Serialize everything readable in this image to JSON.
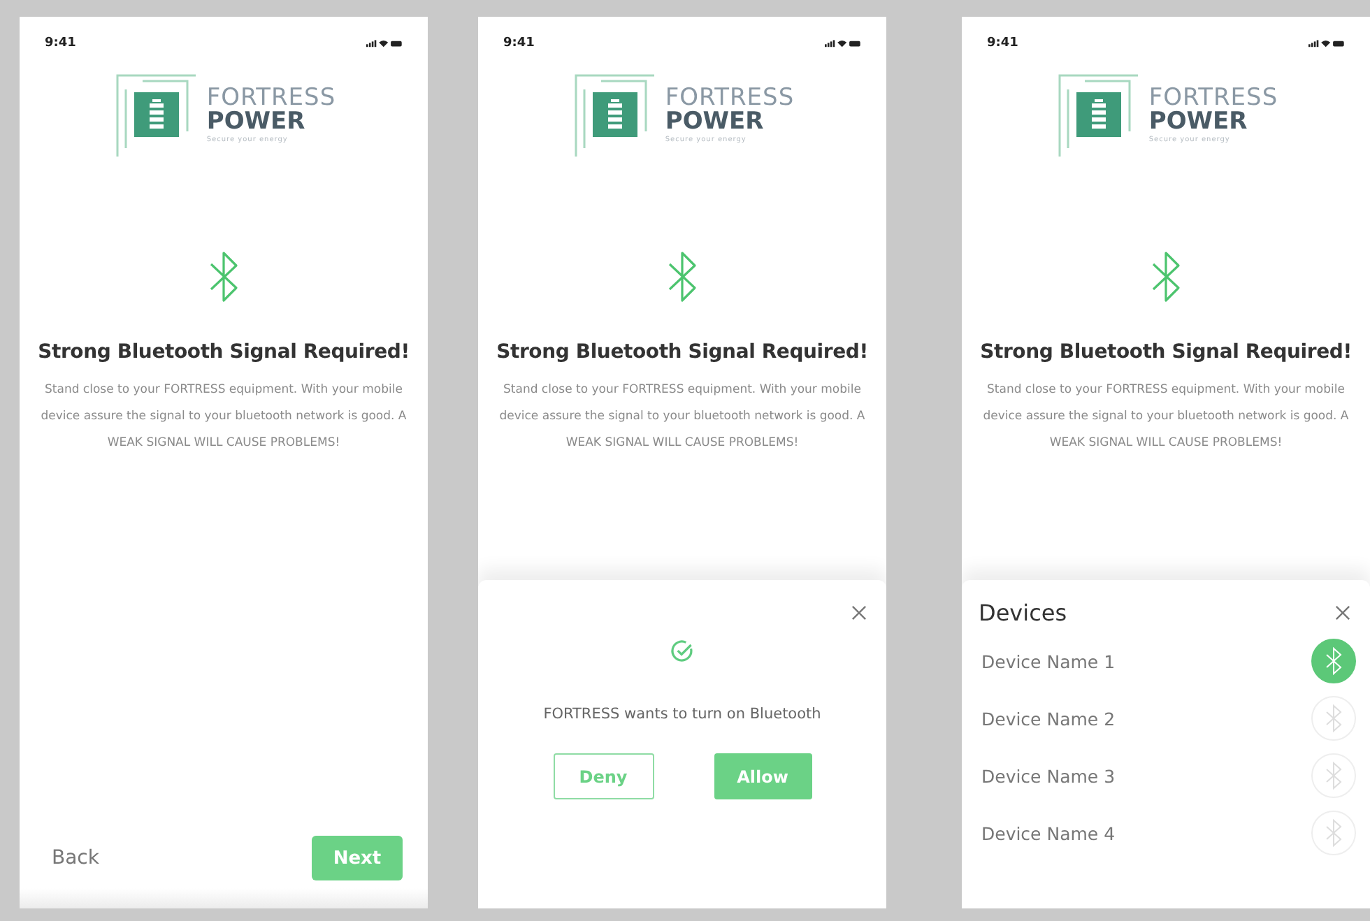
{
  "screens": [
    {
      "kind": "intro",
      "status": {
        "time": "9:41"
      },
      "logo": {
        "line1": "FORTRESS",
        "line2": "POWER",
        "tagline": "Secure your energy"
      },
      "title": "Strong Bluetooth Signal Required!",
      "body": "Stand close to your FORTRESS equipment. With your mobile device assure the signal to your bluetooth network is good. A WEAK SIGNAL WILL CAUSE PROBLEMS!",
      "footer": {
        "back": "Back",
        "next": "Next"
      }
    },
    {
      "kind": "permission",
      "status": {
        "time": "9:41"
      },
      "logo": {
        "line1": "FORTRESS",
        "line2": "POWER",
        "tagline": "Secure your energy"
      },
      "title": "Strong Bluetooth Signal Required!",
      "body": "Stand close to your FORTRESS equipment. With your mobile device assure the signal to your bluetooth network is good. A WEAK SIGNAL WILL CAUSE PROBLEMS!",
      "sheet": {
        "message": "FORTRESS wants to turn on Bluetooth",
        "deny": "Deny",
        "allow": "Allow"
      }
    },
    {
      "kind": "devices",
      "status": {
        "time": "9:41"
      },
      "logo": {
        "line1": "FORTRESS",
        "line2": "POWER",
        "tagline": "Secure your energy"
      },
      "title": "Strong Bluetooth Signal Required!",
      "body": "Stand close to your FORTRESS equipment. With your mobile device assure the signal to your bluetooth network is good. A WEAK SIGNAL WILL CAUSE PROBLEMS!",
      "sheet": {
        "heading": "Devices",
        "devices": [
          {
            "name": "Device Name 1",
            "selected": true
          },
          {
            "name": "Device Name 2",
            "selected": false
          },
          {
            "name": "Device Name 3",
            "selected": false
          },
          {
            "name": "Device Name 4",
            "selected": false
          }
        ]
      }
    }
  ]
}
